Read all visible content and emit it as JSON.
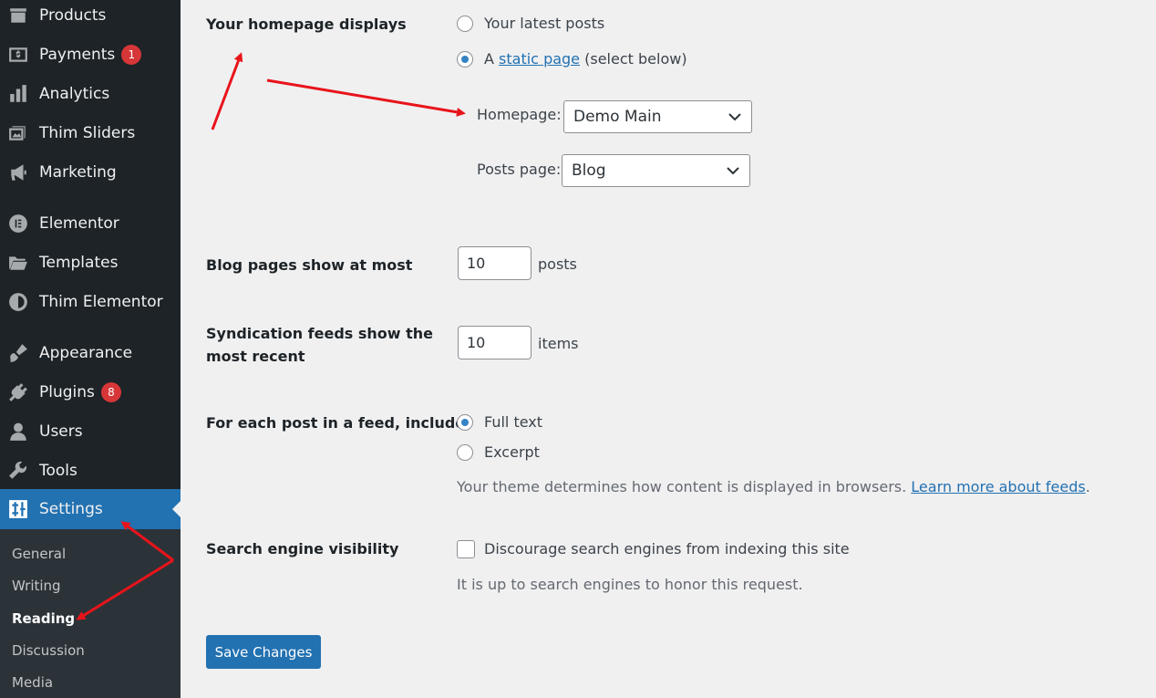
{
  "sidebar": {
    "items": [
      {
        "label": "Products",
        "icon": "products-icon"
      },
      {
        "label": "Payments",
        "icon": "payments-icon",
        "badge": "1"
      },
      {
        "label": "Analytics",
        "icon": "analytics-icon"
      },
      {
        "label": "Thim Sliders",
        "icon": "sliders-icon"
      },
      {
        "label": "Marketing",
        "icon": "megaphone-icon"
      },
      {
        "label": "Elementor",
        "icon": "elementor-icon"
      },
      {
        "label": "Templates",
        "icon": "folder-icon"
      },
      {
        "label": "Thim Elementor",
        "icon": "thim-elementor-icon"
      },
      {
        "label": "Appearance",
        "icon": "brush-icon"
      },
      {
        "label": "Plugins",
        "icon": "plugin-icon",
        "badge": "8"
      },
      {
        "label": "Users",
        "icon": "user-icon"
      },
      {
        "label": "Tools",
        "icon": "wrench-icon"
      },
      {
        "label": "Settings",
        "icon": "settings-icon"
      }
    ],
    "submenu": [
      "General",
      "Writing",
      "Reading",
      "Discussion",
      "Media"
    ]
  },
  "homepage": {
    "label": "Your homepage displays",
    "option_latest": "Your latest posts",
    "option_static_prefix": "A",
    "option_static_link": "static page",
    "option_static_suffix": "(select below)",
    "homepage_label": "Homepage:",
    "homepage_value": "Demo Main",
    "posts_label": "Posts page:",
    "posts_value": "Blog"
  },
  "blog_pages": {
    "label": "Blog pages show at most",
    "value": "10",
    "unit": "posts"
  },
  "syndication": {
    "label_line1": "Syndication feeds show the",
    "label_line2": "most recent",
    "value": "10",
    "unit": "items"
  },
  "feed": {
    "label": "For each post in a feed, include",
    "option_full": "Full text",
    "option_excerpt": "Excerpt",
    "desc": "Your theme determines how content is displayed in browsers.",
    "link": "Learn more about feeds",
    "link_suffix": "."
  },
  "search": {
    "label": "Search engine visibility",
    "checkbox_label": "Discourage search engines from indexing this site",
    "desc": "It is up to search engines to honor this request."
  },
  "save_label": "Save Changes",
  "colors": {
    "accent": "#2271b1",
    "sidebar": "#1d2327",
    "annotation": "#e8141b"
  }
}
